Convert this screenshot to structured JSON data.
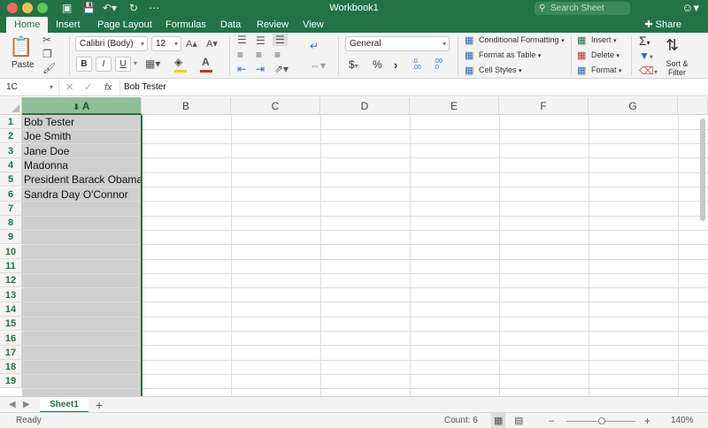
{
  "window": {
    "title": "Workbook1",
    "search_placeholder": "Search Sheet",
    "share_label": "Share"
  },
  "tabs": [
    "Home",
    "Insert",
    "Page Layout",
    "Formulas",
    "Data",
    "Review",
    "View"
  ],
  "active_tab": "Home",
  "ribbon": {
    "paste_label": "Paste",
    "font_name": "Calibri (Body)",
    "font_size": "12",
    "bold": "B",
    "italic": "I",
    "underline": "U",
    "number_format": "General",
    "currency": "$",
    "percent": "%",
    "comma": "›",
    "inc_decimal": ".0 .00",
    "dec_decimal": ".00 .0",
    "conditional_formatting": "Conditional Formatting",
    "format_as_table": "Format as Table",
    "cell_styles": "Cell Styles",
    "insert": "Insert",
    "delete": "Delete",
    "format": "Format",
    "sort_filter_line1": "Sort &",
    "sort_filter_line2": "Filter",
    "font_color": "#d62a2a",
    "highlight_color": "#f4d000"
  },
  "formula_bar": {
    "name_box": "1C",
    "fx_label": "fx",
    "value": "Bob Tester"
  },
  "columns": [
    "A",
    "B",
    "C",
    "D",
    "E",
    "F",
    "G"
  ],
  "selected_column": "A",
  "rows": [
    "1",
    "2",
    "3",
    "4",
    "5",
    "6",
    "7",
    "8",
    "9",
    "10",
    "11",
    "12",
    "13",
    "14",
    "15",
    "16",
    "17",
    "18",
    "19"
  ],
  "cells_A": [
    "Bob Tester",
    "Joe Smith",
    "Jane Doe",
    "Madonna",
    "President Barack Obama",
    "Sandra Day O'Connor"
  ],
  "sheets": [
    "Sheet1"
  ],
  "status": {
    "mode": "Ready",
    "count": "Count: 6",
    "zoom": "140%",
    "zoom_minus": "–",
    "zoom_plus": "+"
  },
  "colors": {
    "accent": "#217346",
    "selection_fill": "#cfcfcf",
    "header_selected": "#8fbf99"
  }
}
